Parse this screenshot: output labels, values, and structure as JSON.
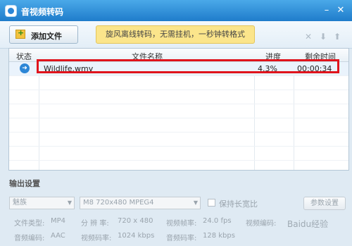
{
  "window": {
    "title": "音视频转码",
    "minimize_glyph": "–",
    "close_glyph": "✕"
  },
  "toolbar": {
    "add_label": "添加文件",
    "promo": "旋风离线转码，无需挂机，一秒钟转格式",
    "icons": [
      "close-icon",
      "arrow-down-icon",
      "arrow-up-icon"
    ],
    "icon_glyphs": [
      "✕",
      "⬇",
      "⬆"
    ]
  },
  "table": {
    "headers": {
      "status": "状态",
      "name": "文件名称",
      "progress": "进度",
      "remaining": "剩余时间"
    },
    "rows": [
      {
        "status_icon": "arrow-right-icon",
        "status_glyph": "➜",
        "name": "Wildlife.wmv",
        "progress": "4.3%",
        "remaining": "00:00:34"
      }
    ]
  },
  "output": {
    "section_title": "输出设置",
    "preset": "魅族",
    "format": "M8 720x480 MPEG4",
    "keep_ratio_label": "保持长宽比",
    "param_button": "参数设置",
    "file_type_label": "文件类型:",
    "file_type": "MP4",
    "resolution_label": "分 辨 率:",
    "resolution": "720 x 480",
    "video_fps_label": "视频帧率:",
    "video_fps": "24.0 fps",
    "video_codec_label": "视频编码:",
    "audio_codec_label": "音频编码:",
    "audio_codec": "AAC",
    "video_bitrate_label": "视频码率:",
    "video_bitrate": "1024 kbps",
    "audio_bitrate_label": "音频码率:",
    "audio_bitrate": "128 kbps"
  },
  "watermark": "Baidu经验"
}
